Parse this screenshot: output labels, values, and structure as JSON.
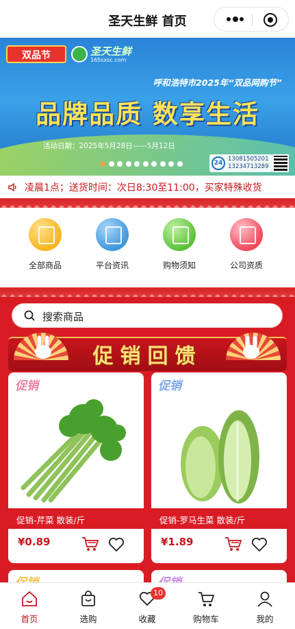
{
  "header": {
    "title": "圣天生鲜 首页"
  },
  "banner": {
    "badge": "双品节",
    "logo_text": "圣天生鲜",
    "logo_url": "165sxsc.com",
    "city_line": "呼和浩特市2025年“双品网购节”",
    "slogan": "品牌品质 数享生活",
    "date": "活动日期：2025年5月28日——5月12日",
    "hotline_label": "24",
    "hotline_1": "13081505201",
    "hotline_2": "13234713289",
    "slide_count": 10,
    "active_slide": 0
  },
  "notice": {
    "text": "凌晨1点；送货时间：次日8:30至11:00，买家特殊收货"
  },
  "categories": [
    {
      "label": "全部商品",
      "icon": "grid-icon",
      "color": "#f5b520"
    },
    {
      "label": "平台资讯",
      "icon": "document-search-icon",
      "color": "#3f97dc"
    },
    {
      "label": "购物须知",
      "icon": "cart-notice-icon",
      "color": "#5cc13a"
    },
    {
      "label": "公司资质",
      "icon": "certificate-icon",
      "color": "#ef4a5c"
    }
  ],
  "search": {
    "placeholder": "搜索商品"
  },
  "promo": {
    "title": "促销回馈"
  },
  "products": [
    {
      "tag": "促销",
      "tag_color": "#ef7fa0",
      "name": "促销-芹菜 散装/斤",
      "price": "¥0.89"
    },
    {
      "tag": "促销",
      "tag_color": "#7fa6e8",
      "name": "促销-罗马生菜 散装/斤",
      "price": "¥1.89"
    }
  ],
  "peek": [
    {
      "tag": "促销",
      "tag_color": "#f4c24a"
    },
    {
      "tag": "促销",
      "tag_color": "#c98ae8"
    }
  ],
  "tabbar": [
    {
      "label": "首页",
      "icon": "home-icon",
      "active": true
    },
    {
      "label": "选购",
      "icon": "shopping-bag-icon",
      "active": false
    },
    {
      "label": "收藏",
      "icon": "heart-icon",
      "active": false,
      "badge": "10"
    },
    {
      "label": "购物车",
      "icon": "cart-icon",
      "active": false
    },
    {
      "label": "我的",
      "icon": "user-icon",
      "active": false
    }
  ],
  "colors": {
    "brand_red": "#d91c24",
    "price_red": "#c8161d"
  }
}
